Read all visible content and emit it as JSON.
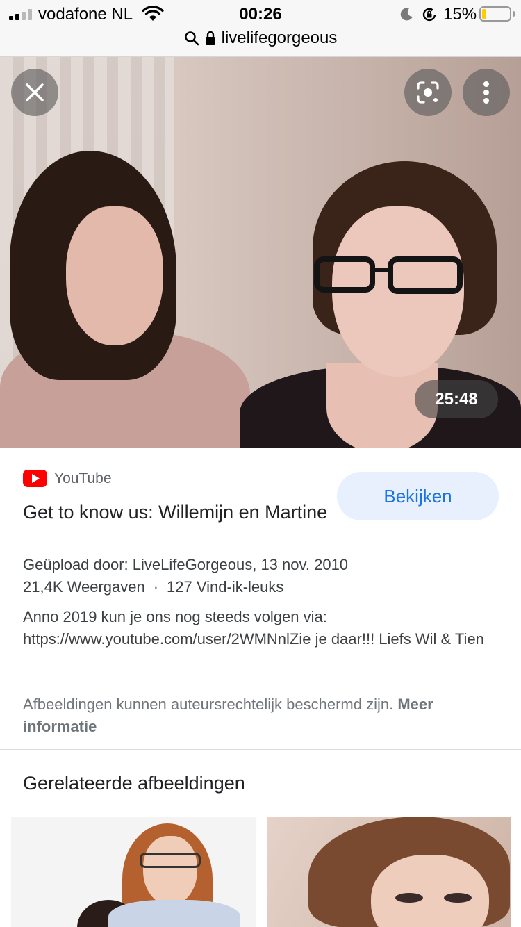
{
  "status_bar": {
    "carrier": "vodafone NL",
    "time": "00:26",
    "battery_percent": "15%",
    "battery_level": 0.15
  },
  "url_bar": {
    "domain": "livelifegorgeous"
  },
  "viewer": {
    "duration": "25:48"
  },
  "result": {
    "source": "YouTube",
    "watch_label": "Bekijken",
    "title": "Get to know us: Willemijn en Martine",
    "uploaded": "Geüpload door: LiveLifeGorgeous, 13 nov. 2010",
    "views": "21,4K Weergaven",
    "separator": "·",
    "likes": "127 Vind-ik-leuks",
    "description": "Anno 2019 kun je ons nog steeds volgen via: https://www.youtube.com/user/2WMNnlZie je daar!!! Liefs Wil & Tien",
    "copyright_text": "Afbeeldingen kunnen auteursrechtelijk beschermd zijn.",
    "more_info": "Meer informatie"
  },
  "related": {
    "heading": "Gerelateerde afbeeldingen"
  },
  "colors": {
    "accent_blue": "#1a73e8",
    "watch_bg": "#e8f0fe",
    "youtube_red": "#ff0000",
    "battery_yellow": "#ffcc00"
  }
}
